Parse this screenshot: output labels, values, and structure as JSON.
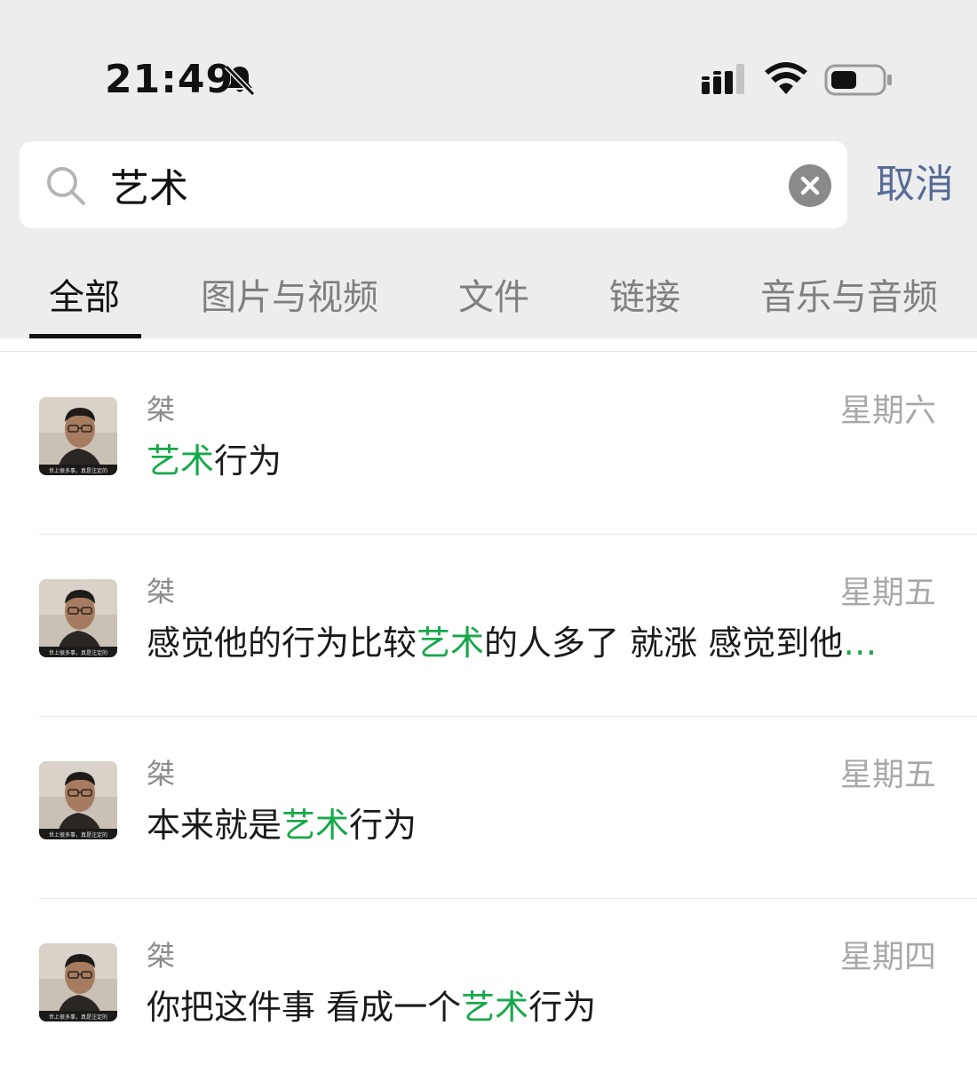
{
  "status": {
    "time": "21:49",
    "icons": [
      "bell-slash-icon",
      "cellular-signal-icon",
      "wifi-icon",
      "battery-icon"
    ]
  },
  "search": {
    "query": "艺术",
    "cancel_label": "取消"
  },
  "tabs": [
    {
      "label": "全部",
      "active": true
    },
    {
      "label": "图片与视频",
      "active": false
    },
    {
      "label": "文件",
      "active": false
    },
    {
      "label": "链接",
      "active": false
    },
    {
      "label": "音乐与音频",
      "active": false
    }
  ],
  "results": [
    {
      "sender": "桀",
      "date": "星期六",
      "before": "",
      "highlight": "艺术",
      "after": "行为",
      "ellipsis": ""
    },
    {
      "sender": "桀",
      "date": "星期五",
      "before": "感觉他的行为比较",
      "highlight": "艺术",
      "after": "的人多了 就涨 感觉到他",
      "ellipsis": "…"
    },
    {
      "sender": "桀",
      "date": "星期五",
      "before": "本来就是",
      "highlight": "艺术",
      "after": "行为",
      "ellipsis": ""
    },
    {
      "sender": "桀",
      "date": "星期四",
      "before": "你把这件事 看成一个",
      "highlight": "艺术",
      "after": "行为",
      "ellipsis": ""
    }
  ],
  "avatar_caption": "世上很多事，真是注定的",
  "colors": {
    "highlight": "#17a84a",
    "link": "#576b95",
    "header_bg": "#ededed"
  }
}
